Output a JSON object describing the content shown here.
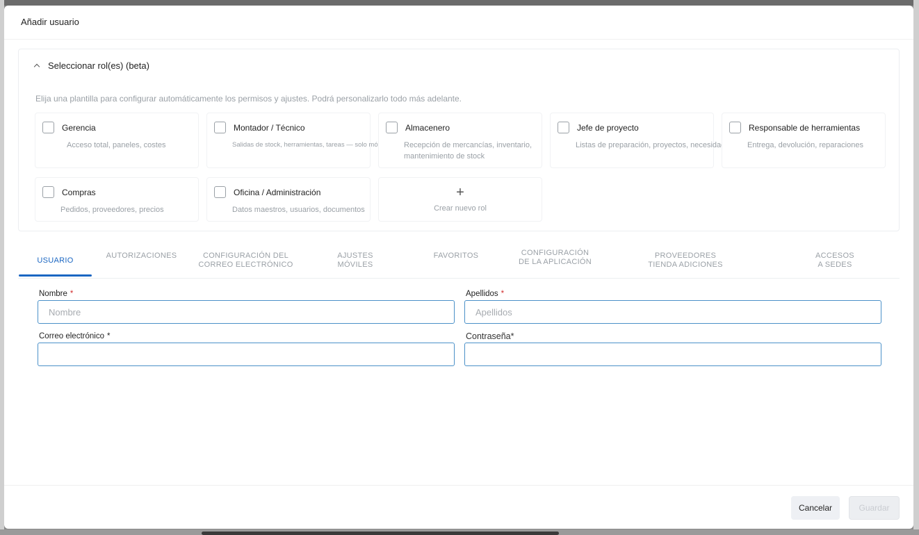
{
  "modal": {
    "title": "Añadir usuario"
  },
  "roles": {
    "title": "Seleccionar rol(es) (beta)",
    "description": "Elija una plantilla para configurar automáticamente los permisos y ajustes. Podrá personalizarlo todo más adelante.",
    "items": [
      {
        "name": "Gerencia",
        "desc": "Acceso total, paneles, costes",
        "checked": false
      },
      {
        "name": "Montador / Técnico",
        "desc": "Salidas de stock, herramientas, tareas — solo móvil",
        "checked": false
      },
      {
        "name": "Almacenero",
        "desc": "Recepción de mercancías, inventario, mantenimiento de stock",
        "checked": false
      },
      {
        "name": "Jefe de proyecto",
        "desc": "Listas de preparación, proyectos, necesidades...",
        "checked": false
      },
      {
        "name": "Responsable de herramientas",
        "desc": "Entrega, devolución, reparaciones",
        "checked": false
      },
      {
        "name": "Compras",
        "desc": "Pedidos, proveedores, precios",
        "checked": false
      },
      {
        "name": "Oficina / Administración",
        "desc": "Datos maestros, usuarios, documentos",
        "checked": false
      }
    ],
    "create_label": "Crear nuevo rol"
  },
  "tabs": {
    "usuario": "USUARIO",
    "autorizaciones": "AUTORIZACIONES",
    "correo_1": "CONFIGURACIÓN DEL",
    "correo_2": "CORREO ELECTRÓNICO",
    "moviles_1": "AJUSTES",
    "moviles_2": "MÓVILES",
    "favoritos": "FAVORITOS",
    "app_1": "CONFIGURACIÓN",
    "app_2": "DE LA APLICACIÓN",
    "prov_1": "PROVEEDORES",
    "prov_2": "TIENDA ADICIONES",
    "sedes_1": "ACCESOS",
    "sedes_2": "A SEDES",
    "active": "usuario"
  },
  "form": {
    "nombre_label": "Nombre",
    "nombre_placeholder": "Nombre",
    "apellidos_label": "Apellidos",
    "apellidos_placeholder": "Apellidos",
    "email_label": "Correo electrónico",
    "password_label": "Contraseña*",
    "required_mark": "*"
  },
  "footer": {
    "cancel_label": "Cancelar",
    "save_label": "Guardar"
  },
  "colors": {
    "accent": "#1a66c2",
    "required": "#d32f2f",
    "field_border": "#4a90c8"
  }
}
